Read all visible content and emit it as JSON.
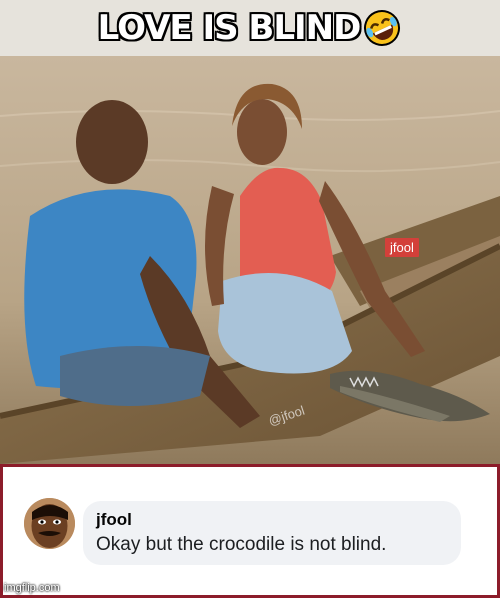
{
  "caption": {
    "text": "LOVE IS BLIND",
    "emoji": "rolling-on-floor-laughing-emoji"
  },
  "photo": {
    "watermark_badge": "jfool",
    "watermark_handle": "@jfool"
  },
  "comment": {
    "author": "jfool",
    "text": "Okay but the crocodile is not blind.",
    "border_color": "#8c1c2a",
    "bubble_color": "#f0f2f5"
  },
  "footer": {
    "site_watermark": "imgflip.com"
  }
}
